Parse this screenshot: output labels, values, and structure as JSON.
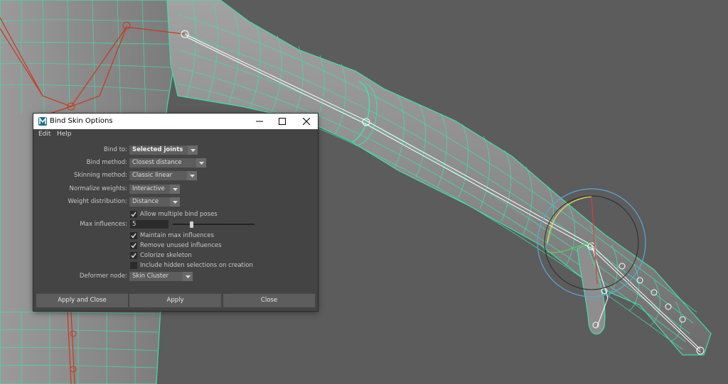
{
  "dialog": {
    "title": "Bind Skin Options",
    "menu": [
      "Edit",
      "Help"
    ],
    "window_buttons": {
      "minimize": "–",
      "maximize": "☐",
      "close": "✕"
    },
    "fields": {
      "bind_to": {
        "label": "Bind to:",
        "value": "Selected joints"
      },
      "bind_method": {
        "label": "Bind method:",
        "value": "Closest distance"
      },
      "skinning_method": {
        "label": "Skinning method:",
        "value": "Classic linear"
      },
      "normalize_weights": {
        "label": "Normalize weights:",
        "value": "Interactive"
      },
      "weight_distribution": {
        "label": "Weight distribution:",
        "value": "Distance"
      },
      "allow_multiple_bind_poses": {
        "label": "Allow multiple bind poses",
        "checked": true
      },
      "max_influences": {
        "label": "Max influences:",
        "value": "5",
        "slider_fraction": 0.22
      },
      "maintain_max_influences": {
        "label": "Maintain max influences",
        "checked": true
      },
      "remove_unused_influences": {
        "label": "Remove unused influences",
        "checked": true
      },
      "colorize_skeleton": {
        "label": "Colorize skeleton",
        "checked": true
      },
      "include_hidden_selections": {
        "label": "Include hidden selections on creation",
        "checked": false
      },
      "deformer_node": {
        "label": "Deformer node:",
        "value": "Skin Cluster"
      }
    },
    "buttons": {
      "apply_and_close": "Apply and Close",
      "apply": "Apply",
      "close": "Close"
    }
  },
  "colors": {
    "viewport_background": "#5c5c5c",
    "wireframe": "#3fe0a8",
    "joint": "#c8381c",
    "dialog_background": "#444444",
    "field_background": "#5d5d5d"
  }
}
